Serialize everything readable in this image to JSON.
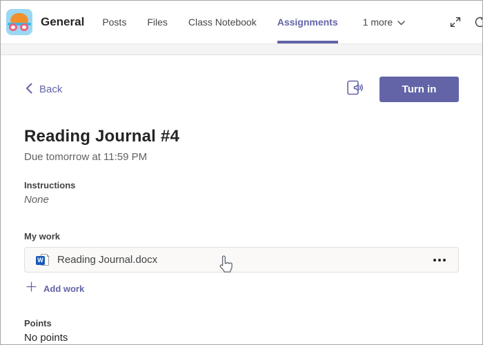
{
  "header": {
    "team_name": "General",
    "tabs": [
      {
        "label": "Posts",
        "active": false
      },
      {
        "label": "Files",
        "active": false
      },
      {
        "label": "Class Notebook",
        "active": false
      },
      {
        "label": "Assignments",
        "active": true
      }
    ],
    "more_tabs": "1 more",
    "icons": [
      "chevron-down-icon",
      "expand-icon",
      "refresh-icon"
    ]
  },
  "toolbar": {
    "back_label": "Back",
    "turn_in_label": "Turn in",
    "icons": [
      "back-chevron-icon",
      "immersive-reader-icon"
    ]
  },
  "assignment": {
    "title": "Reading Journal #4",
    "due_text": "Due tomorrow at 11:59 PM",
    "instructions": {
      "label": "Instructions",
      "value": "None"
    },
    "my_work": {
      "label": "My work",
      "files": [
        {
          "name": "Reading Journal.docx",
          "type": "docx",
          "icon": "word-file-icon"
        }
      ],
      "add_work_label": "Add work"
    },
    "points": {
      "label": "Points",
      "value": "No points"
    }
  },
  "icons": {
    "word_glyph": "W"
  },
  "colors": {
    "accent": "#6264a7",
    "header_text": "#252423",
    "tab_text": "#484644",
    "muted_text": "#616161",
    "card_bg": "#faf9f8",
    "card_border": "#e1dfdd",
    "word_blue": "#185abd",
    "avatar_bg": "#9bd7f3",
    "avatar_cap": "#f0912d",
    "avatar_goggles": "#e8647c"
  }
}
